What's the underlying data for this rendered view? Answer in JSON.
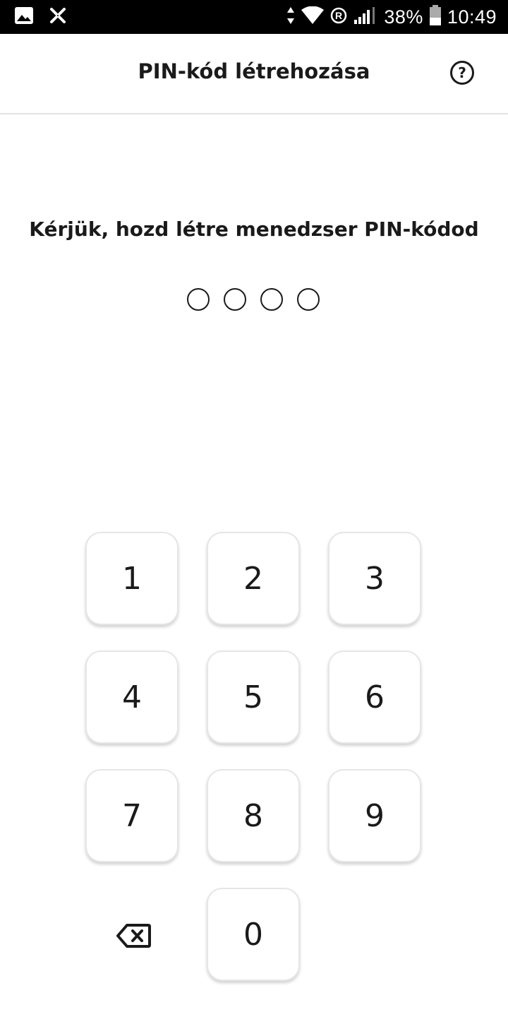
{
  "status_bar": {
    "battery": "38%",
    "time": "10:49",
    "icons": [
      "image-icon",
      "app-notification-icon",
      "data-arrows-icon",
      "wifi-icon",
      "roaming-icon",
      "signal-icon",
      "battery-icon"
    ]
  },
  "header": {
    "title": "PIN-kód létrehozása",
    "help_icon": "help-icon",
    "help_label": "?"
  },
  "main": {
    "prompt": "Kérjük, hozd létre menedzser PIN-kódod",
    "pin_length": 4,
    "pin_filled": 0
  },
  "keypad": {
    "keys": [
      "1",
      "2",
      "3",
      "4",
      "5",
      "6",
      "7",
      "8",
      "9",
      "0"
    ],
    "backspace_icon": "backspace-icon"
  }
}
